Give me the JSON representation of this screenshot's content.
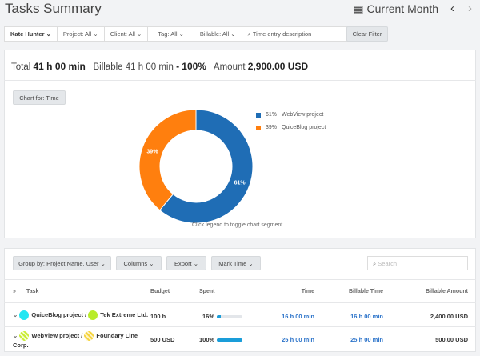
{
  "header": {
    "title": "Tasks Summary",
    "period": "Current Month",
    "prev_icon": "chevron-left-icon",
    "next_icon": "chevron-right-icon",
    "calendar_icon": "calendar-icon"
  },
  "filters": {
    "user": "Kate Hunter",
    "project": "Project: All",
    "client": "Client: All",
    "tag": "Tag: All",
    "billable": "Billable: All",
    "search_placeholder": "Time entry description",
    "clear": "Clear Filter"
  },
  "summary": {
    "total_label": "Total",
    "total": "41 h 00 min",
    "billable_label": "Billable",
    "billable": "41 h 00 min",
    "dash": "-",
    "billable_pct": "100%",
    "amount_label": "Amount",
    "amount": "2,900.00 USD"
  },
  "chart": {
    "button": "Chart for: Time",
    "hint": "Click legend to toggle chart segment."
  },
  "chart_data": {
    "type": "pie",
    "donut": true,
    "legend_position": "right",
    "series": [
      {
        "name": "WebView project",
        "value": 61,
        "label": "61%",
        "color": "#1f6db5"
      },
      {
        "name": "QuiceBlog project",
        "value": 39,
        "label": "39%",
        "color": "#ff7f0e"
      }
    ]
  },
  "toolbar": {
    "group_by": "Group by: Project Name, User",
    "columns": "Columns",
    "export": "Export",
    "mark_time": "Mark Time",
    "search_placeholder": "Search"
  },
  "table": {
    "headers": {
      "task": "Task",
      "budget": "Budget",
      "spent": "Spent",
      "time": "Time",
      "billable_time": "Billable Time",
      "billable_amount": "Billable Amount"
    },
    "rows": [
      {
        "project": "QuiceBlog project",
        "sep": "/",
        "client": "Tek Extreme Ltd.",
        "budget": "100 h",
        "spent": "16%",
        "spent_value": 16,
        "time": "16 h 00 min",
        "billable_time": "16 h 00 min",
        "amount": "2,400.00 USD"
      },
      {
        "project": "WebView project",
        "sep": "/",
        "client": "Foundary Line Corp.",
        "budget": "500 USD",
        "spent": "100%",
        "spent_value": 100,
        "time": "25 h 00 min",
        "billable_time": "25 h 00 min",
        "amount": "500.00 USD"
      }
    ]
  }
}
